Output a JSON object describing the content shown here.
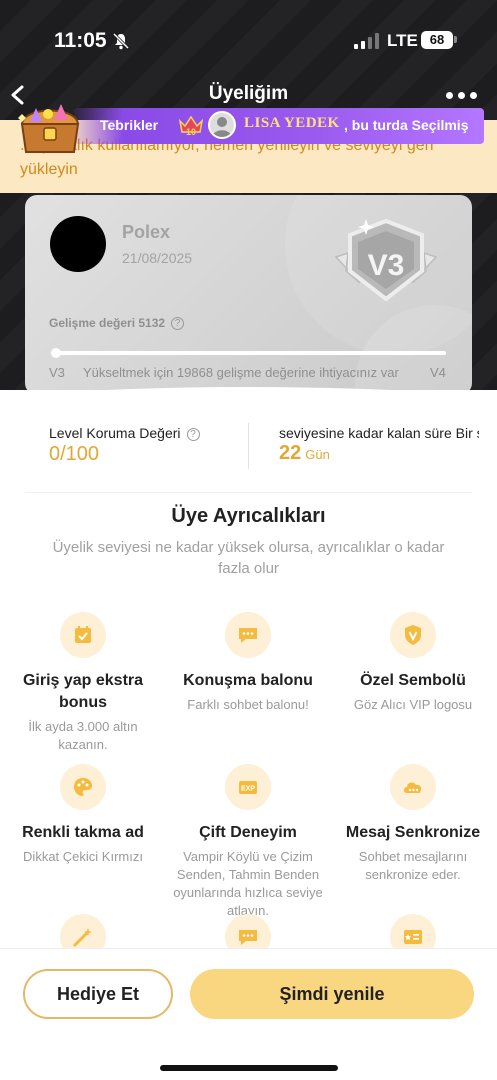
{
  "status_bar": {
    "time": "11:05",
    "network": "LTE",
    "battery": "68"
  },
  "nav": {
    "title": "Üyeliğim"
  },
  "notice": {
    "text": "...ayrıcalık kullanılamıyor, hemen yenileyin ve seviyeyi geri yükleyin"
  },
  "banner": {
    "prefix": "Tebrikler",
    "badge": "10",
    "name": "LISA YEDEK",
    "suffix": ", bu turda Seçilmiş"
  },
  "card": {
    "username": "Polex",
    "date": "21/08/2025",
    "level_badge": "V3",
    "growth_label": "Gelişme değeri 5132",
    "growth_progress": 0.0,
    "level_from": "V3",
    "level_to": "V4",
    "progress_hint": "Yükseltmek için 19868 gelişme değerine ihtiyacınız var"
  },
  "stats": {
    "protection_label": "Level Koruma Değeri",
    "protection_value": "0/100",
    "remaining_label": "seviyesine kadar kalan süre  Bir s",
    "remaining_days": "22",
    "remaining_unit": "Gün"
  },
  "privileges": {
    "title": "Üye Ayrıcalıkları",
    "subtitle": "Üyelik seviyesi ne kadar yüksek olursa, ayrıcalıklar o kadar fazla olur",
    "items": [
      {
        "name": "Giriş yap ekstra bonus",
        "desc": "İlk ayda 3.000 altın kazanın.",
        "icon": "calendar-check-icon"
      },
      {
        "name": "Konuşma balonu",
        "desc": "Farklı sohbet balonu!",
        "icon": "chat-bubble-icon"
      },
      {
        "name": "Özel Sembolü",
        "desc": "Göz Alıcı VIP logosu",
        "icon": "vip-shield-icon"
      },
      {
        "name": "Renkli takma ad",
        "desc": "Dikkat Çekici Kırmızı",
        "icon": "palette-icon"
      },
      {
        "name": "Çift Deneyim",
        "desc": "Vampir Köylü ve Çizim Senden, Tahmin Benden oyunlarında hızlıca seviye atlayın.",
        "icon": "exp-card-icon"
      },
      {
        "name": "Mesaj Senkronize",
        "desc": "Sohbet mesajlarını senkronize eder.",
        "icon": "cloud-chat-icon"
      },
      {
        "name": "",
        "desc": "",
        "icon": "magic-wand-icon"
      },
      {
        "name": "",
        "desc": "",
        "icon": "message-icon"
      },
      {
        "name": "",
        "desc": "",
        "icon": "id-card-icon"
      }
    ]
  },
  "footer": {
    "gift_label": "Hediye Et",
    "renew_label": "Şimdi yenile"
  },
  "colors": {
    "accent": "#e0a934",
    "button": "#f9d680",
    "icon_bg": "#fdf0d6",
    "banner": "#8a4ae6"
  }
}
